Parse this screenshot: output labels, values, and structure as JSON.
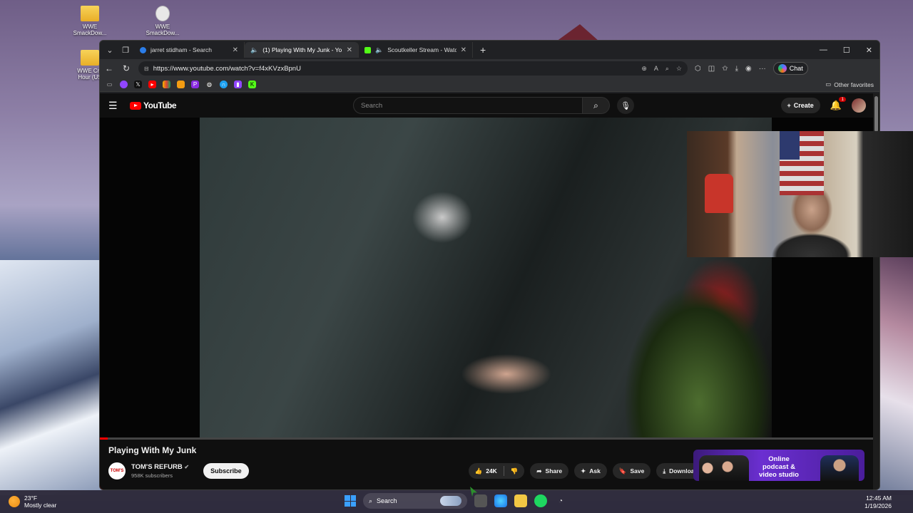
{
  "desktop": {
    "icons": [
      {
        "label": "WWE SmackDow..."
      },
      {
        "label": "WWE SmackDow..."
      },
      {
        "label": "WWE Cru Hour (US"
      }
    ]
  },
  "browser": {
    "tabs": [
      {
        "title": "jarret stidham - Search",
        "icon": "bing-icon"
      },
      {
        "title": "(1) Playing With My Junk - Yo",
        "icon": "youtube-icon"
      },
      {
        "title": "Scoutkeller Stream - Watch Li",
        "icon": "kick-icon"
      }
    ],
    "url": "https://www.youtube.com/watch?v=f4xKVzxBpnU",
    "chat_label": "Chat",
    "other_favorites": "Other favorites"
  },
  "youtube": {
    "logo_text": "YouTube",
    "search_placeholder": "Search",
    "create_label": "Create",
    "notification_count": "1",
    "video": {
      "title": "Playing With My Junk",
      "progress": 0.01
    },
    "channel": {
      "name": "TOM'S REFURB",
      "subscribers": "958K subscribers",
      "logo_text": "TOM'S"
    },
    "subscribe_label": "Subscribe",
    "actions": {
      "likes": "24K",
      "share": "Share",
      "ask": "Ask",
      "save": "Save",
      "download": "Download"
    },
    "ad": {
      "text": "Online podcast & video studio"
    }
  },
  "taskbar": {
    "weather_temp": "23°F",
    "weather_desc": "Mostly clear",
    "search_label": "Search",
    "time": "12:45 AM",
    "date": "1/19/2026"
  }
}
